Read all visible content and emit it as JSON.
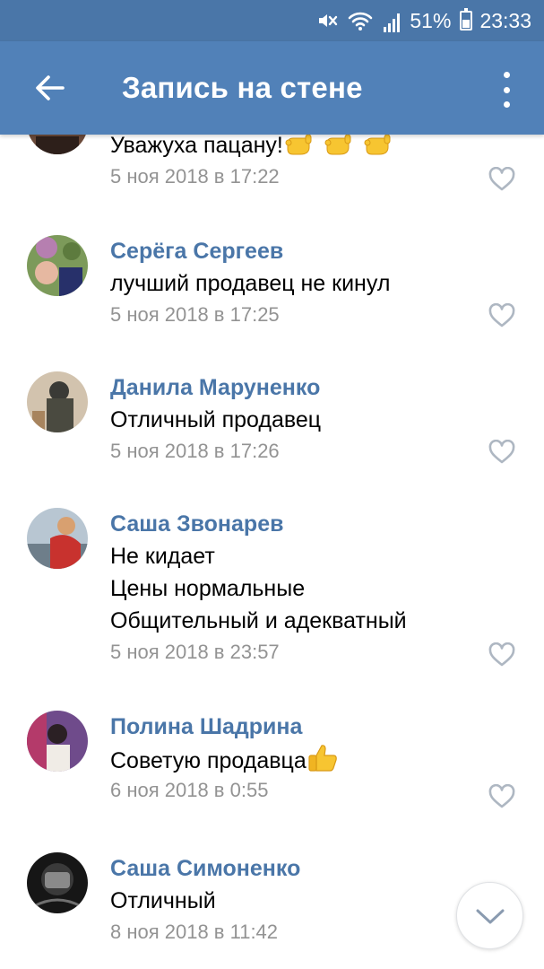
{
  "status_bar": {
    "battery": "51%",
    "time": "23:33",
    "icons": [
      "mute-icon",
      "wifi-icon",
      "signal-icon",
      "battery-icon"
    ]
  },
  "app_bar": {
    "title": "Запись на стене",
    "back_icon": "arrow-left-icon",
    "menu_icon": "more-vertical-icon"
  },
  "colors": {
    "status_bar": "#4a76a8",
    "app_bar": "#5181b8",
    "author_link": "#4a76a8",
    "date_text": "#939393",
    "like_icon": "#aeb7c2"
  },
  "comments": [
    {
      "author": "",
      "lines": [
        "Уважуха пацану!"
      ],
      "emoji": "call-me-hand x3",
      "date": "5 ноя 2018 в 17:22"
    },
    {
      "author": "Серёга Сергеев",
      "lines": [
        "лучший продавец не кинул"
      ],
      "date": "5 ноя 2018 в 17:25"
    },
    {
      "author": "Данила Маруненко",
      "lines": [
        "Отличный продавец"
      ],
      "date": "5 ноя 2018 в 17:26"
    },
    {
      "author": "Саша Звонарев",
      "lines": [
        "Не кидает",
        "Цены нормальные",
        "Общительный и адекватный"
      ],
      "date": "5 ноя 2018 в 23:57"
    },
    {
      "author": "Полина Шадрина",
      "lines": [
        "Советую продавца"
      ],
      "emoji": "thumbs-up",
      "date": "6 ноя 2018 в 0:55"
    },
    {
      "author": "Саша Симоненко",
      "lines": [
        "Отличный"
      ],
      "date": "8 ноя 2018 в 11:42"
    }
  ],
  "scroll_button_icon": "chevron-down-icon"
}
